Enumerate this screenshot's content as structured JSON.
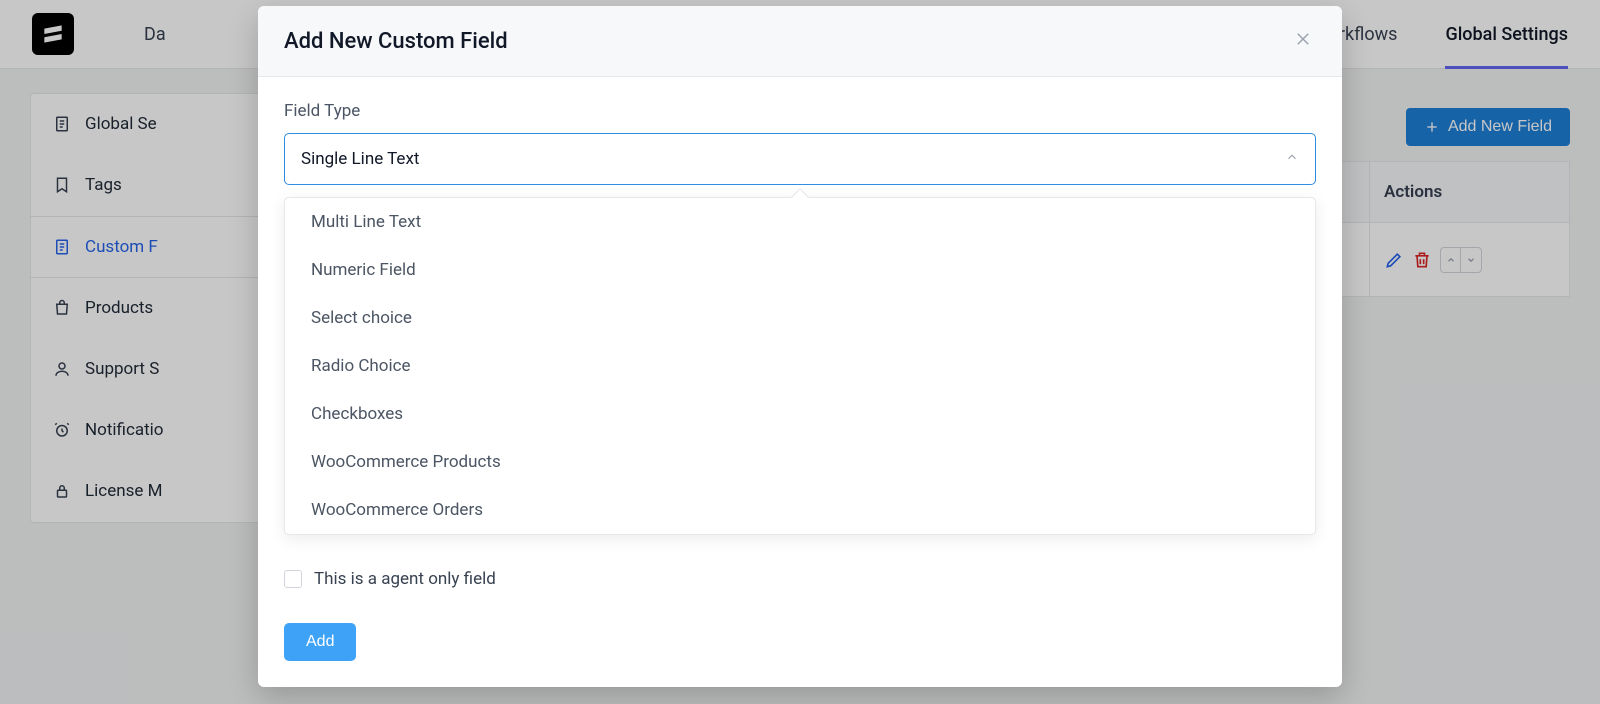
{
  "topnav": {
    "left_trunc": "Da",
    "right_partial": "s",
    "workflows": "Workflows",
    "global_settings": "Global Settings"
  },
  "sidebar": {
    "items": [
      {
        "label": "Global Se"
      },
      {
        "label": "Tags"
      },
      {
        "label": "Custom F"
      },
      {
        "label": "Products"
      },
      {
        "label": "Support S"
      },
      {
        "label": "Notificatio"
      },
      {
        "label": "License M"
      }
    ]
  },
  "main": {
    "add_field_btn": "Add New Field",
    "table": {
      "col_actions": "Actions"
    }
  },
  "modal": {
    "title": "Add New Custom Field",
    "field_type_label": "Field Type",
    "selected_value": "Single Line Text",
    "options": [
      "Multi Line Text",
      "Numeric Field",
      "Select choice",
      "Radio Choice",
      "Checkboxes",
      "WooCommerce Products",
      "WooCommerce Orders"
    ],
    "agent_only_label": "This is a agent only field",
    "add_btn": "Add"
  }
}
